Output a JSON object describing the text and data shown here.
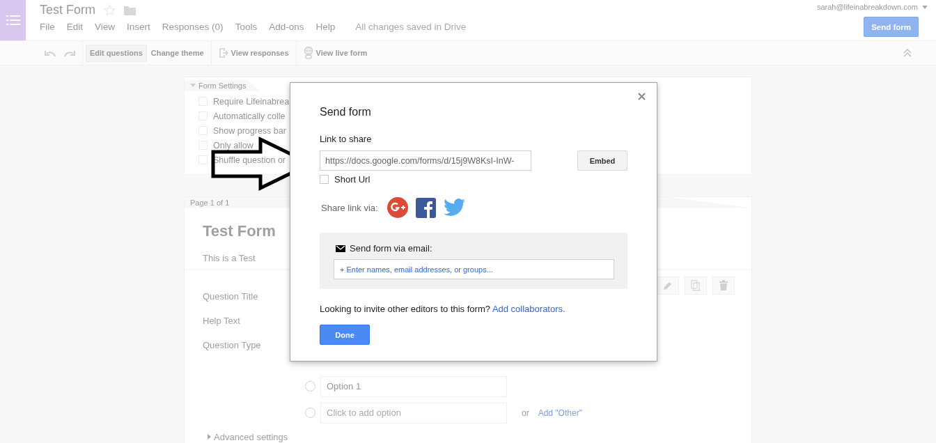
{
  "app": {
    "title": "Test Form",
    "menu": [
      "File",
      "Edit",
      "View",
      "Insert",
      "Responses (0)",
      "Tools",
      "Add-ons",
      "Help"
    ],
    "save_status": "All changes saved in Drive",
    "account": "sarah@lifeinabreakdown.com",
    "send_button": "Send form"
  },
  "toolbar": {
    "buttons": [
      {
        "label": "Edit questions",
        "selected": true,
        "kind": "plain"
      },
      {
        "label": "Change theme",
        "selected": false,
        "kind": "plain"
      },
      {
        "label": "View responses",
        "selected": false,
        "kind": "responses"
      },
      {
        "label": "View live form",
        "selected": false,
        "kind": "live"
      }
    ]
  },
  "settings": {
    "title": "Form Settings",
    "expanded": true,
    "items": [
      {
        "label": "Require Lifeinabrea",
        "checked": false
      },
      {
        "label": "Automatically colle",
        "checked": false
      },
      {
        "label": "Show progress bar",
        "checked": false
      },
      {
        "label": "Only allow",
        "checked": false
      },
      {
        "label": "Shuffle question or",
        "checked": false
      }
    ]
  },
  "page": {
    "indicator": "Page 1 of 1",
    "title": "Test Form",
    "description": "This is a Test"
  },
  "question": {
    "labels": [
      "Question Title",
      "Help Text",
      "Question Type"
    ],
    "options": [
      {
        "value": "Option 1",
        "selected": false
      },
      {
        "placeholder": "Click to add option",
        "selected": false
      }
    ],
    "or_text": "or",
    "add_other": "Add \"Other\"",
    "advanced": "Advanced settings"
  },
  "dialog": {
    "title": "Send form",
    "link_label": "Link to share",
    "link_value": "https://docs.google.com/forms/d/15j9W8KsI-InW-",
    "embed": "Embed",
    "short_url": {
      "label": "Short Url",
      "checked": false
    },
    "share_label": "Share link via:",
    "email_label": "Send form via email:",
    "email_placeholder": "+ Enter names, email addresses, or groups...",
    "invite_text": "Looking to invite other editors to this form?",
    "invite_link": "Add collaborators.",
    "done": "Done"
  }
}
